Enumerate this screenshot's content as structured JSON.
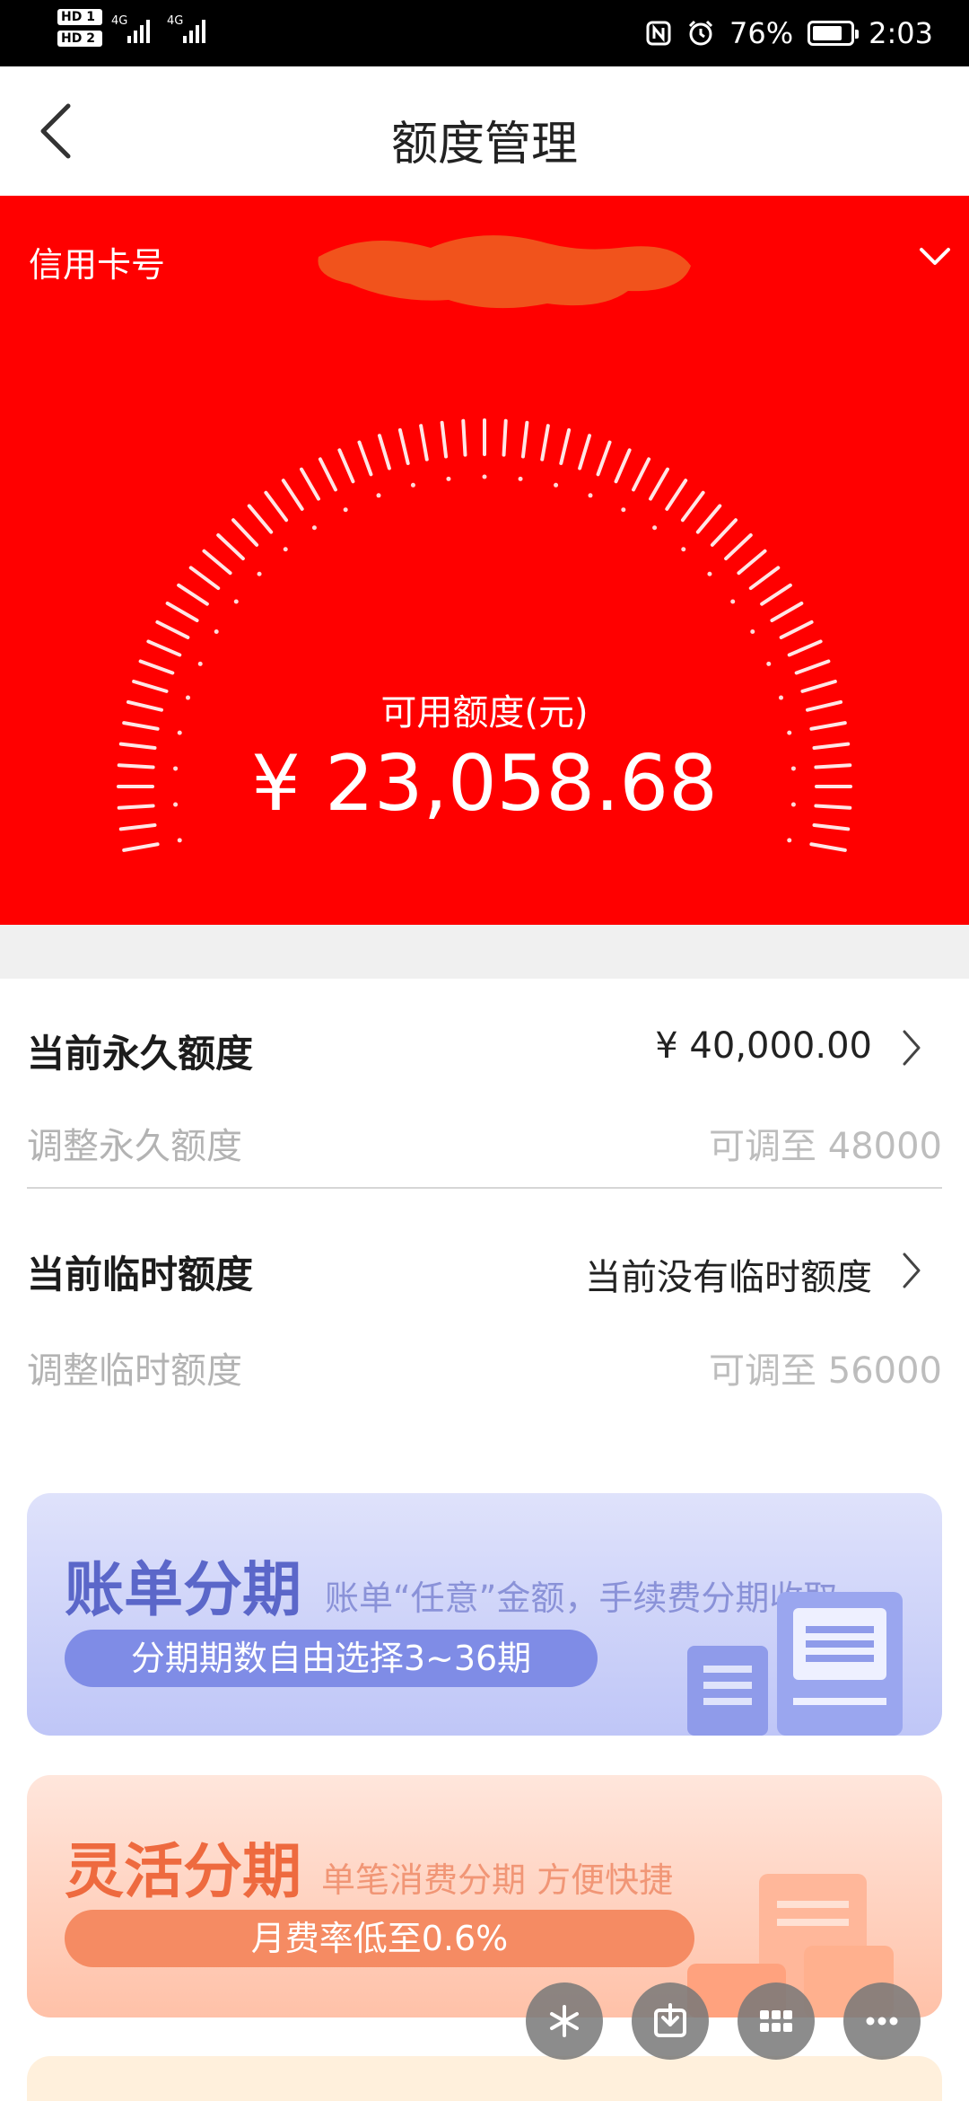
{
  "status_bar": {
    "hd1": "HD 1",
    "hd2": "HD 2",
    "net1": "4G",
    "net2": "4G",
    "battery": "76%",
    "time": "2:03",
    "icons": [
      "nfc-icon",
      "alarm-icon",
      "battery-icon"
    ]
  },
  "nav": {
    "title": "额度管理",
    "back_icon": "chevron-left-icon"
  },
  "card": {
    "label": "信用卡号",
    "expand_icon": "chevron-down-icon"
  },
  "available": {
    "label": "可用额度(元)",
    "amount": "¥ 23,058.68"
  },
  "permanent": {
    "title": "当前永久额度",
    "value": "¥ 40,000.00",
    "adjust_label": "调整永久额度",
    "adjust_value": "可调至 48000"
  },
  "temporary": {
    "title": "当前临时额度",
    "value": "当前没有临时额度",
    "adjust_label": "调整临时额度",
    "adjust_value": "可调至 56000"
  },
  "promos": {
    "bill": {
      "title": "账单分期",
      "desc": "账单“任意”金额，手续费分期收取",
      "pill": "分期期数自由选择3~36期"
    },
    "flex": {
      "title": "灵活分期",
      "desc": "单笔消费分期  方便快捷",
      "pill": "月费率低至0.6%"
    }
  },
  "fabs": [
    "sparkle-icon",
    "download-icon",
    "grid-icon",
    "more-icon"
  ],
  "colors": {
    "hero_red": "#ff0000",
    "bill_accent": "#5b67c9",
    "flex_accent": "#ee6a3f"
  }
}
